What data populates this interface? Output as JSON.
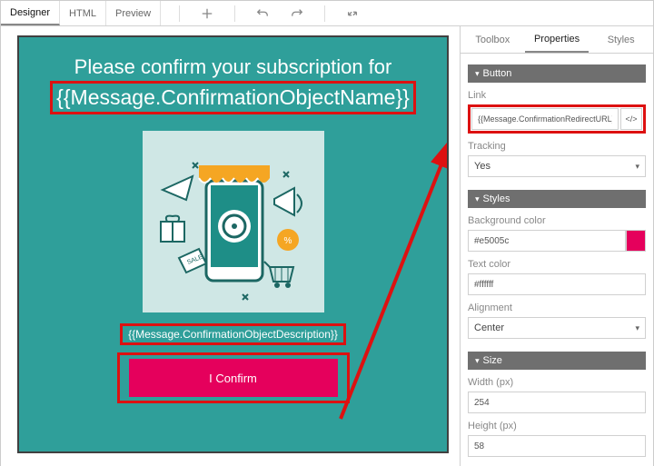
{
  "topTabs": {
    "designer": "Designer",
    "html": "HTML",
    "preview": "Preview"
  },
  "canvas": {
    "titleLine": "Please confirm your subscription for",
    "objectName": "{{Message.ConfirmationObjectName}}",
    "description": "{{Message.ConfirmationObjectDescription}}",
    "confirmButton": "I Confirm"
  },
  "rightPanel": {
    "tabs": {
      "toolbox": "Toolbox",
      "properties": "Properties",
      "styles": "Styles"
    },
    "buttonSection": {
      "title": "Button",
      "linkLabel": "Link",
      "linkValue": "{{Message.ConfirmationRedirectURL}}",
      "trackingLabel": "Tracking",
      "trackingValue": "Yes"
    },
    "stylesSection": {
      "title": "Styles",
      "bgLabel": "Background color",
      "bgValue": "#e5005c",
      "textLabel": "Text color",
      "textValue": "#ffffff",
      "alignLabel": "Alignment",
      "alignValue": "Center"
    },
    "sizeSection": {
      "title": "Size",
      "widthLabel": "Width (px)",
      "widthValue": "254",
      "heightLabel": "Height (px)",
      "heightValue": "58"
    }
  },
  "annotations": {
    "highlightColor": "#d11",
    "arrowFrom": "confirm-button",
    "arrowTo": "link-input"
  }
}
